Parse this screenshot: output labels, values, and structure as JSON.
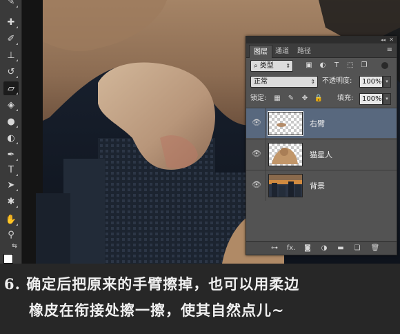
{
  "toolbar": {
    "tools": [
      {
        "name": "eyedropper-icon",
        "glyph": "✎"
      },
      {
        "name": "healing-brush-icon",
        "glyph": "✚"
      },
      {
        "name": "brush-icon",
        "glyph": "✐"
      },
      {
        "name": "clone-stamp-icon",
        "glyph": "⊥"
      },
      {
        "name": "history-brush-icon",
        "glyph": "↺"
      },
      {
        "name": "eraser-icon",
        "glyph": "▱"
      },
      {
        "name": "paint-bucket-icon",
        "glyph": "◈"
      },
      {
        "name": "blur-icon",
        "glyph": "●"
      },
      {
        "name": "dodge-icon",
        "glyph": "◐"
      },
      {
        "name": "pen-icon",
        "glyph": "✒"
      },
      {
        "name": "type-icon",
        "glyph": "T"
      },
      {
        "name": "path-selection-icon",
        "glyph": "➤"
      },
      {
        "name": "custom-shape-icon",
        "glyph": "✱"
      },
      {
        "name": "hand-icon",
        "glyph": "✋"
      },
      {
        "name": "zoom-icon",
        "glyph": "⚲"
      }
    ],
    "active_tool": "eraser-icon",
    "swap_glyph": "⇆"
  },
  "panel": {
    "tabs": [
      "图层",
      "通道",
      "路径"
    ],
    "active_tab": "图层",
    "menu_glyph": "≡",
    "collapse_glyph": "◂◂",
    "close_glyph": "✕",
    "filter": {
      "kind_label": "类型",
      "kind_icon": "⌕",
      "filter_icons": [
        {
          "name": "pixel-filter-icon",
          "glyph": "▣"
        },
        {
          "name": "adjustment-filter-icon",
          "glyph": "◐"
        },
        {
          "name": "type-filter-icon",
          "glyph": "T"
        },
        {
          "name": "shape-filter-icon",
          "glyph": "⬚"
        },
        {
          "name": "smart-object-filter-icon",
          "glyph": "❐"
        }
      ]
    },
    "blend_mode": "正常",
    "opacity_label": "不透明度:",
    "opacity_value": "100%",
    "lock_label": "锁定:",
    "lock_icons": [
      {
        "name": "lock-transparent-icon",
        "glyph": "▦"
      },
      {
        "name": "lock-image-icon",
        "glyph": "✎"
      },
      {
        "name": "lock-position-icon",
        "glyph": "✥"
      },
      {
        "name": "lock-all-icon",
        "glyph": "🔒"
      }
    ],
    "fill_label": "填充:",
    "fill_value": "100%",
    "layers": [
      {
        "name": "右臂",
        "selected": true
      },
      {
        "name": "猫星人",
        "selected": false
      },
      {
        "name": "背景",
        "selected": false
      }
    ],
    "bottom_icons": [
      {
        "name": "link-layers-icon",
        "glyph": "⊶"
      },
      {
        "name": "layer-style-icon",
        "glyph": "fx."
      },
      {
        "name": "add-mask-icon",
        "glyph": "◙"
      },
      {
        "name": "adjustment-layer-icon",
        "glyph": "◑"
      },
      {
        "name": "new-group-icon",
        "glyph": "▬"
      },
      {
        "name": "new-layer-icon",
        "glyph": "❏"
      },
      {
        "name": "delete-layer-icon",
        "glyph": "🗑"
      }
    ]
  },
  "caption": {
    "line1": "6.  确定后把原来的手臂擦掉，也可以用柔边",
    "line2": "橡皮在衔接处擦一擦，使其自然点儿~"
  }
}
